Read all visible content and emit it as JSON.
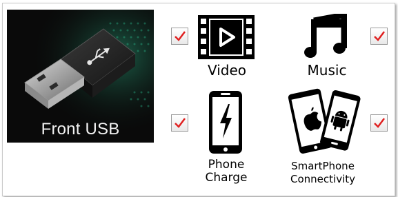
{
  "source": {
    "label": "Front USB",
    "icon": "usb-flash-drive-icon"
  },
  "features": [
    {
      "key": "video",
      "label": "Video",
      "icon": "film-play-icon",
      "checked": true
    },
    {
      "key": "music",
      "label": "Music",
      "icon": "music-note-icon",
      "checked": true
    },
    {
      "key": "phone_charge",
      "label_line1": "Phone",
      "label_line2": "Charge",
      "icon": "phone-charge-icon",
      "checked": true
    },
    {
      "key": "smartphone",
      "label_line1": "SmartPhone",
      "label_line2": "Connectivity",
      "icon": "smartphones-icon",
      "checked": true
    }
  ],
  "colors": {
    "check_mark": "#e02020",
    "tile_bg": "#0a0a0a",
    "accent_dots": "#2ecc9a"
  }
}
